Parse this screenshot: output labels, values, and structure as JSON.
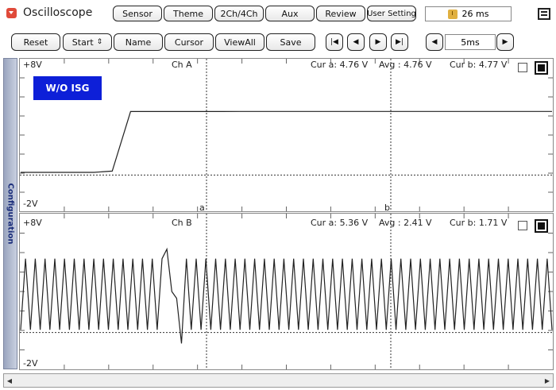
{
  "app": {
    "title": "Oscilloscope"
  },
  "topmenu": {
    "sensor": "Sensor",
    "theme": "Theme",
    "channels": "2Ch/4Ch",
    "aux": "Aux",
    "review": "Review",
    "user_setting": "User Setting",
    "readout": "26 ms"
  },
  "toolbar": {
    "reset": "Reset",
    "start": "Start",
    "name": "Name",
    "cursor": "Cursor",
    "viewall": "ViewAll",
    "save": "Save",
    "time_div": "5ms"
  },
  "sidebar": {
    "label": "Configuration"
  },
  "channel_a": {
    "name": "Ch A",
    "top": "+8V",
    "bottom": "-2V",
    "cur_a": "Cur a: 4.76 V",
    "avg": "Avg : 4.76 V",
    "cur_b": "Cur b: 4.77 V",
    "badge": "W/O ISG",
    "marker_a": "a",
    "marker_b": "b"
  },
  "channel_b": {
    "name": "Ch B",
    "top": "+8V",
    "bottom": "-2V",
    "cur_a": "Cur a: 5.36 V",
    "avg": "Avg : 2.41 V",
    "cur_b": "Cur b: 1.71 V"
  },
  "chart_data": [
    {
      "type": "line",
      "title": "Ch A",
      "ylim": [
        -2,
        8
      ],
      "series": [
        {
          "values": [
            0.2,
            0.2,
            0.2,
            0.2,
            0.2,
            0.3,
            4.76,
            4.76,
            4.76,
            4.76,
            4.76,
            4.76,
            4.77,
            4.77,
            4.77,
            4.77,
            4.77,
            4.77,
            4.77,
            4.77,
            4.77,
            4.77,
            4.77,
            4.77,
            4.77,
            4.77,
            4.77,
            4.77,
            4.77,
            4.77
          ]
        }
      ]
    },
    {
      "type": "line",
      "title": "Ch B",
      "ylim": [
        -2,
        8
      ],
      "series": [
        {
          "values": [
            0.2,
            5.4,
            0.2,
            5.4,
            0.2,
            5.4,
            0.2,
            5.4,
            0.2,
            5.4,
            0.2,
            5.4,
            0.2,
            5.4,
            0.2,
            5.4,
            0.2,
            5.4,
            0.2,
            5.4,
            0.2,
            5.4,
            0.2,
            5.4,
            0.2,
            5.4,
            0.2,
            5.4,
            0.2,
            5.4,
            6.1,
            3.0,
            2.5,
            -0.8,
            5.4,
            0.2,
            5.4,
            0.2,
            5.4,
            0.2,
            5.4,
            0.2,
            5.4,
            0.2,
            5.4,
            0.2,
            5.4,
            0.2,
            5.4,
            0.2,
            5.4,
            0.2,
            5.4,
            0.2,
            5.4,
            0.2,
            5.4,
            0.2,
            5.4,
            0.2,
            5.4,
            0.2,
            5.4,
            0.2,
            5.4,
            0.2,
            5.4,
            0.2,
            5.4,
            0.2,
            5.4,
            0.2,
            5.4,
            0.2,
            5.4,
            0.2,
            5.4,
            0.2,
            5.4,
            0.2,
            5.4,
            0.2,
            5.4,
            0.2,
            5.4,
            0.2,
            5.4,
            0.2,
            5.4,
            0.2,
            5.4,
            0.2,
            5.4,
            0.2,
            5.4,
            0.2,
            5.4,
            0.2,
            5.4,
            0.2,
            5.4,
            0.2,
            5.4,
            0.2,
            5.4,
            0.2,
            5.4,
            0.2,
            5.4,
            0.2
          ]
        }
      ]
    }
  ]
}
